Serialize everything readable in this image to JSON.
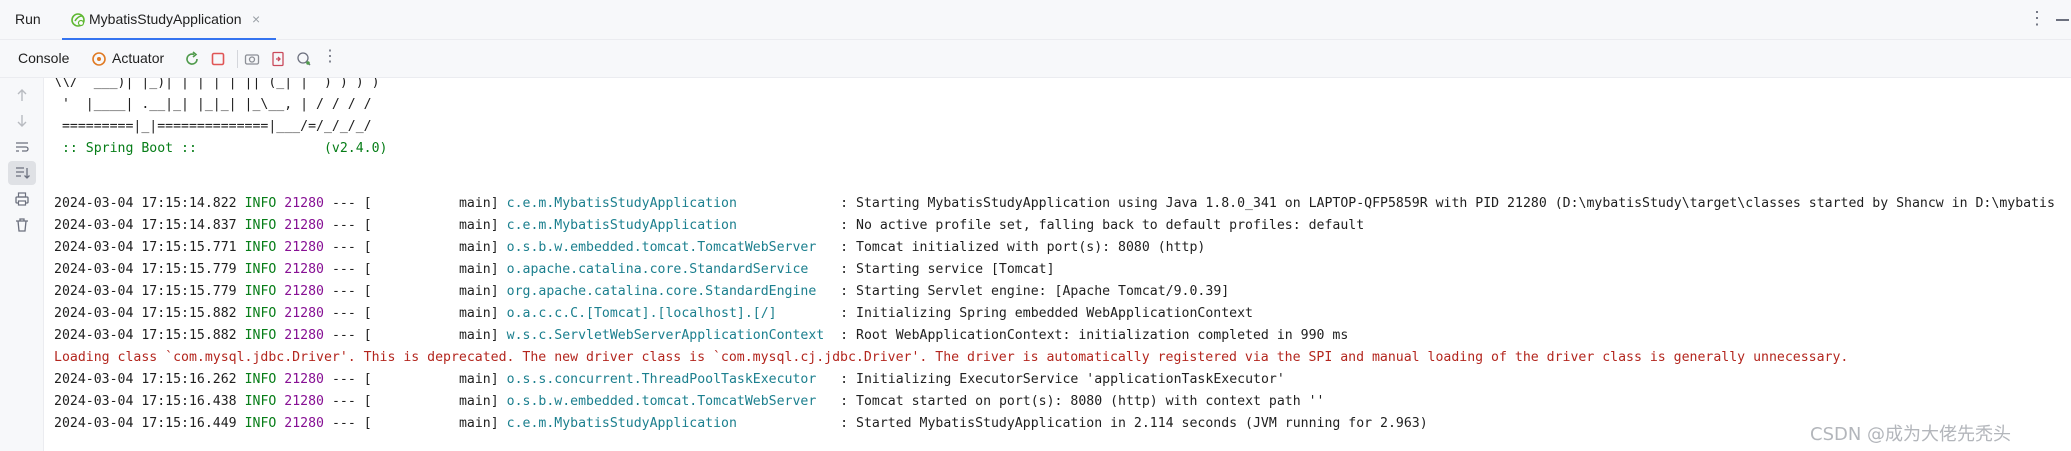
{
  "tabbar": {
    "run_label": "Run",
    "tab_title": "MybatisStudyApplication",
    "close_glyph": "×",
    "more_glyph": "⋮"
  },
  "toolbar": {
    "console_label": "Console",
    "actuator_label": "Actuator",
    "more_glyph": "⋮",
    "icons": [
      "rerun-icon",
      "stop-icon",
      "camera-icon",
      "export-icon",
      "settings-search-icon"
    ]
  },
  "gutter": {
    "icons": [
      "arrow-up-icon",
      "arrow-down-icon",
      "soft-wrap-icon",
      "scroll-to-end-icon",
      "print-icon",
      "trash-icon"
    ]
  },
  "banner": [
    "\\\\/  ___)| |_)| | | | | || (_| |  ) ) ) )",
    " '  |____| .__|_| |_|_| |_\\__, | / / / /",
    " =========|_|==============|___/=/_/_/_/",
    " :: Spring Boot ::                (v2.4.0)"
  ],
  "log": [
    {
      "ts": "2024-03-04 17:15:14.822",
      "level": "INFO",
      "pid": "21280",
      "sep": "--- [",
      "thread": "           main]",
      "logger": "c.e.m.MybatisStudyApplication",
      "pad": "           ",
      "msg": ": Starting MybatisStudyApplication using Java 1.8.0_341 on LAPTOP-QFP5859R with PID 21280 (D:\\mybatisStudy\\target\\classes started by Shancw in D:\\mybatis"
    },
    {
      "ts": "2024-03-04 17:15:14.837",
      "level": "INFO",
      "pid": "21280",
      "sep": "--- [",
      "thread": "           main]",
      "logger": "c.e.m.MybatisStudyApplication",
      "pad": "           ",
      "msg": ": No active profile set, falling back to default profiles: default"
    },
    {
      "ts": "2024-03-04 17:15:15.771",
      "level": "INFO",
      "pid": "21280",
      "sep": "--- [",
      "thread": "           main]",
      "logger": "o.s.b.w.embedded.tomcat.TomcatWebServer",
      "pad": " ",
      "msg": ": Tomcat initialized with port(s): 8080 (http)"
    },
    {
      "ts": "2024-03-04 17:15:15.779",
      "level": "INFO",
      "pid": "21280",
      "sep": "--- [",
      "thread": "           main]",
      "logger": "o.apache.catalina.core.StandardService",
      "pad": "  ",
      "msg": ": Starting service [Tomcat]"
    },
    {
      "ts": "2024-03-04 17:15:15.779",
      "level": "INFO",
      "pid": "21280",
      "sep": "--- [",
      "thread": "           main]",
      "logger": "org.apache.catalina.core.StandardEngine",
      "pad": " ",
      "msg": ": Starting Servlet engine: [Apache Tomcat/9.0.39]"
    },
    {
      "ts": "2024-03-04 17:15:15.882",
      "level": "INFO",
      "pid": "21280",
      "sep": "--- [",
      "thread": "           main]",
      "logger": "o.a.c.c.C.[Tomcat].[localhost].[/]",
      "pad": "      ",
      "msg": ": Initializing Spring embedded WebApplicationContext"
    },
    {
      "ts": "2024-03-04 17:15:15.882",
      "level": "INFO",
      "pid": "21280",
      "sep": "--- [",
      "thread": "           main]",
      "logger": "w.s.c.ServletWebServerApplicationContext",
      "pad": "",
      "msg": ": Root WebApplicationContext: initialization completed in 990 ms"
    },
    {
      "ts": "2024-03-04 17:15:16.262",
      "level": "INFO",
      "pid": "21280",
      "sep": "--- [",
      "thread": "           main]",
      "logger": "o.s.s.concurrent.ThreadPoolTaskExecutor",
      "pad": " ",
      "msg": ": Initializing ExecutorService 'applicationTaskExecutor'"
    },
    {
      "ts": "2024-03-04 17:15:16.438",
      "level": "INFO",
      "pid": "21280",
      "sep": "--- [",
      "thread": "           main]",
      "logger": "o.s.b.w.embedded.tomcat.TomcatWebServer",
      "pad": " ",
      "msg": ": Tomcat started on port(s): 8080 (http) with context path ''"
    },
    {
      "ts": "2024-03-04 17:15:16.449",
      "level": "INFO",
      "pid": "21280",
      "sep": "--- [",
      "thread": "           main]",
      "logger": "c.e.m.MybatisStudyApplication",
      "pad": "           ",
      "msg": ": Started MybatisStudyApplication in 2.114 seconds (JVM running for 2.963)"
    }
  ],
  "warning": "Loading class `com.mysql.jdbc.Driver'. This is deprecated. The new driver class is `com.mysql.cj.jdbc.Driver'. The driver is automatically registered via the SPI and manual loading of the driver class is generally unnecessary.",
  "watermark": "CSDN @成为大佬先秃头",
  "colors": {
    "level": "#067d17",
    "pid": "#871094",
    "logger": "#1b7f8e",
    "warning": "#b3261e",
    "tab_underline": "#3574f0"
  }
}
